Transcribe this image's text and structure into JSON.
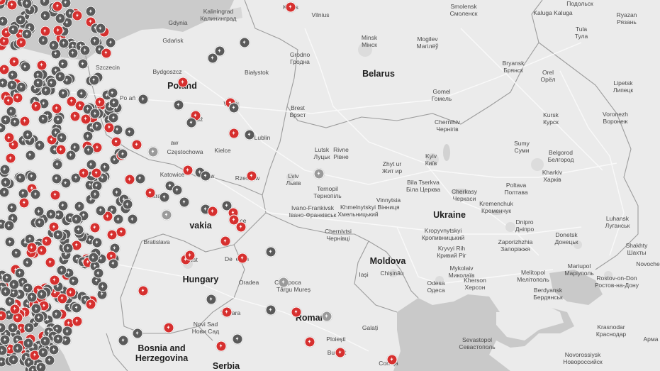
{
  "map": {
    "region": "Eastern Europe",
    "colors": {
      "background": "#ebebeb",
      "sea": "#c9c9c9",
      "border": "#9c9c9c",
      "road": "#ffffff",
      "supercharger": "#d6302f",
      "destination_charger": "#5a5a5a",
      "pin_outline": "#ffffff"
    },
    "countries": [
      {
        "name": "Belarus"
      },
      {
        "name": "Poland"
      },
      {
        "name": "Ukraine"
      },
      {
        "name": "Moldova"
      },
      {
        "name": "Hungary"
      },
      {
        "name": "Slovakia",
        "partial_text": "vakia"
      },
      {
        "name": "Bosnia and\nHerzegovina"
      },
      {
        "name": "Serbia"
      },
      {
        "name": "Romania",
        "partial_text": "Roman"
      }
    ],
    "cities": [
      {
        "name": "Kaunas",
        "partial_text": "Kau s"
      },
      {
        "name": "Vilnius"
      },
      {
        "name": "Smolensk\nСмоленск"
      },
      {
        "name": "Kaliningrad\nКалининград"
      },
      {
        "name": "Gdynia"
      },
      {
        "name": "Gdańsk"
      },
      {
        "name": "Minsk\nМінск"
      },
      {
        "name": "Mogilev\nМагілёў"
      },
      {
        "name": "Kaluga Kaluga"
      },
      {
        "name": "Tula\nТула"
      },
      {
        "name": "Ryazan\nРязань"
      },
      {
        "name": "Podolsk",
        "partial_text": "Подольск"
      },
      {
        "name": "Szczecin"
      },
      {
        "name": "Bydgoszcz"
      },
      {
        "name": "Białystok"
      },
      {
        "name": "Grodno\nГродна"
      },
      {
        "name": "Bryansk\nБрянск"
      },
      {
        "name": "Orel\nОрёл"
      },
      {
        "name": "Lipetsk\nЛипецк"
      },
      {
        "name": "Poznań",
        "partial_text": "Po ań"
      },
      {
        "name": "Warsaw",
        "partial_text": "Wa w"
      },
      {
        "name": "Łódź",
        "partial_text": "Łódź"
      },
      {
        "name": "Brest\nБрэст"
      },
      {
        "name": "Gomel\nГомель"
      },
      {
        "name": "Chernihiv\nЧернігів"
      },
      {
        "name": "Kursk\nКурск"
      },
      {
        "name": "Voronezh\nВоронеж"
      },
      {
        "name": "Lublin"
      },
      {
        "name": "Wrocław",
        "partial_text": "aw"
      },
      {
        "name": "Częstochowa"
      },
      {
        "name": "Kielce"
      },
      {
        "name": "Sumy\nСуми"
      },
      {
        "name": "Lutsk\nЛуцьк"
      },
      {
        "name": "Rivne\nРівне"
      },
      {
        "name": "Zhytomyr\nЖитомир",
        "partial_text": "Zhyt ur\nЖит ир"
      },
      {
        "name": "Kyiv\nКиїв"
      },
      {
        "name": "Belgorod\nБелгород"
      },
      {
        "name": "Katowice"
      },
      {
        "name": "Kraków",
        "partial_text": "ów"
      },
      {
        "name": "Rzeszów",
        "partial_text": "Rzeszów"
      },
      {
        "name": "Lviv\nЛьвів"
      },
      {
        "name": "Ternopil\nТернопіль"
      },
      {
        "name": "Bila Tserkva\nБіла Церква"
      },
      {
        "name": "Kharkiv\nХарків"
      },
      {
        "name": "Ostrava",
        "partial_text": "Ostrava"
      },
      {
        "name": "Vinnytsia\nВінниця"
      },
      {
        "name": "Cherkasy\nЧеркаси"
      },
      {
        "name": "Poltava\nПолтава"
      },
      {
        "name": "Kremenchuk\nКременчук"
      },
      {
        "name": "Ivano-Frankivsk\nІвано-Франківськ"
      },
      {
        "name": "Khmelnytskyi\nХмельницький"
      },
      {
        "name": "Luhansk\nЛуганськ"
      },
      {
        "name": "Košice",
        "partial_text": "K ce"
      },
      {
        "name": "Chernivtsi\nЧернівці"
      },
      {
        "name": "Kropyvnytskyi\nКропивницький"
      },
      {
        "name": "Dnipro\nДніпро"
      },
      {
        "name": "Donetsk\nДонецьк"
      },
      {
        "name": "Bratislava",
        "partial_text": "Bratislava"
      },
      {
        "name": "Kryvyi Rih\nКривий Ріг"
      },
      {
        "name": "Zaporizhzhia\nЗапоріжжя"
      },
      {
        "name": "Shakhty\nШахты"
      },
      {
        "name": "Budapest",
        "partial_text": "B  est"
      },
      {
        "name": "Debrecen",
        "partial_text": "De  ecen"
      },
      {
        "name": "Iași"
      },
      {
        "name": "Chișinău"
      },
      {
        "name": "Mykolaiv\nМиколаїв"
      },
      {
        "name": "Mariupol\nМаріуполь"
      },
      {
        "name": "Novocherkassk",
        "partial_text": "Novoche"
      },
      {
        "name": "Oradea"
      },
      {
        "name": "Cluj-Napoca",
        "partial_text": "Cluj  poca"
      },
      {
        "name": "Melitopol\nМелітополь"
      },
      {
        "name": "Rostov-on-Don\nРостов-на-Дону"
      },
      {
        "name": "Odesa\nОдеса"
      },
      {
        "name": "Kherson\nХерсон"
      },
      {
        "name": "Târgu Mureș"
      },
      {
        "name": "Berdyansk\nБердянськ"
      },
      {
        "name": "Timișoara",
        "partial_text": "Tim ara"
      },
      {
        "name": "Novi Sad\nНови Сад"
      },
      {
        "name": "Galați"
      },
      {
        "name": "Krasnodar\nКраснодар"
      },
      {
        "name": "Armavir",
        "partial_text": "Арма"
      },
      {
        "name": "Sevastopol\nСевастополь"
      },
      {
        "name": "Ploiești"
      },
      {
        "name": "Novorossiysk",
        "partial_text": "Novorossiysk\nНовороссийск"
      },
      {
        "name": "Bucharest",
        "partial_text": "Bu  est"
      },
      {
        "name": "Constanța",
        "partial_text": "Con  ța"
      }
    ]
  }
}
